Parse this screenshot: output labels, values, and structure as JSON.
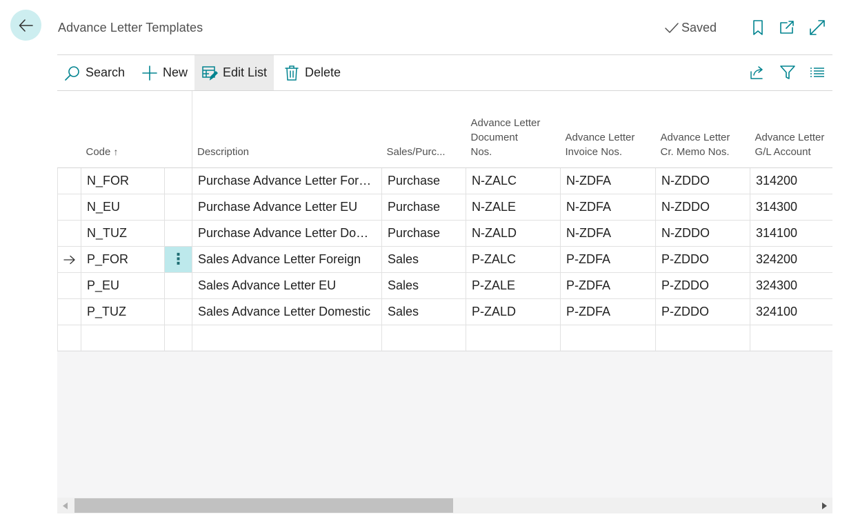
{
  "header": {
    "title": "Advance Letter Templates",
    "saved_label": "Saved"
  },
  "toolbar": {
    "search_label": "Search",
    "new_label": "New",
    "edit_list_label": "Edit List",
    "delete_label": "Delete"
  },
  "table": {
    "columns": {
      "code": "Code",
      "description": "Description",
      "sales_purchase": "Sales/Purc...",
      "doc_nos_1": "Advance Letter",
      "doc_nos_2": "Document",
      "doc_nos_3": "Nos.",
      "inv_nos_1": "Advance Letter",
      "inv_nos_2": "Invoice Nos.",
      "cr_memo_1": "Advance Letter",
      "cr_memo_2": "Cr. Memo Nos.",
      "gl_1": "Advance Letter",
      "gl_2": "G/L Account"
    },
    "rows": [
      {
        "code": "N_FOR",
        "description": "Purchase Advance Letter Foreign",
        "sales_purchase": "Purchase",
        "doc_nos": "N-ZALC",
        "inv_nos": "N-ZDFA",
        "cr_memo_nos": "N-ZDDO",
        "gl_account": "314200"
      },
      {
        "code": "N_EU",
        "description": "Purchase Advance Letter EU",
        "sales_purchase": "Purchase",
        "doc_nos": "N-ZALE",
        "inv_nos": "N-ZDFA",
        "cr_memo_nos": "N-ZDDO",
        "gl_account": "314300"
      },
      {
        "code": "N_TUZ",
        "description": "Purchase Advance Letter Domestic",
        "sales_purchase": "Purchase",
        "doc_nos": "N-ZALD",
        "inv_nos": "N-ZDFA",
        "cr_memo_nos": "N-ZDDO",
        "gl_account": "314100"
      },
      {
        "code": "P_FOR",
        "description": "Sales Advance Letter Foreign",
        "sales_purchase": "Sales",
        "doc_nos": "P-ZALC",
        "inv_nos": "P-ZDFA",
        "cr_memo_nos": "P-ZDDO",
        "gl_account": "324200"
      },
      {
        "code": "P_EU",
        "description": "Sales Advance Letter EU",
        "sales_purchase": "Sales",
        "doc_nos": "P-ZALE",
        "inv_nos": "P-ZDFA",
        "cr_memo_nos": "P-ZDDO",
        "gl_account": "324300"
      },
      {
        "code": "P_TUZ",
        "description": "Sales Advance Letter Domestic",
        "sales_purchase": "Sales",
        "doc_nos": "P-ZALD",
        "inv_nos": "P-ZDFA",
        "cr_memo_nos": "P-ZDDO",
        "gl_account": "324100"
      }
    ]
  },
  "colors": {
    "accent": "#00838f",
    "back_bg": "#cdeef0",
    "selected_cell": "#bde9ec"
  },
  "icons": {
    "back": "arrow-left-icon",
    "saved": "checkmark-icon",
    "bookmark": "bookmark-icon",
    "open_new": "open-new-window-icon",
    "expand": "expand-icon",
    "search": "search-icon",
    "new": "plus-icon",
    "edit_list": "edit-list-icon",
    "delete": "trash-icon",
    "share": "share-icon",
    "filter": "filter-icon",
    "list_view": "list-view-icon"
  }
}
